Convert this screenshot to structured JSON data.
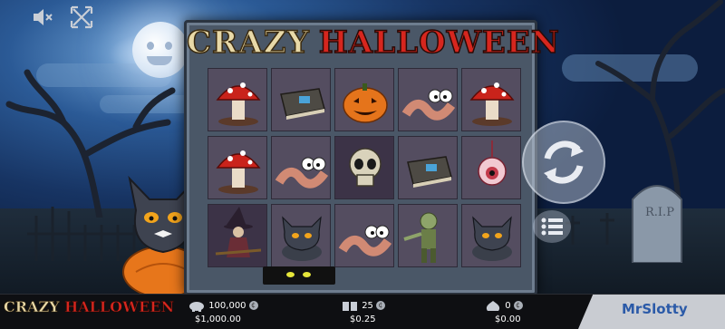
{
  "game": {
    "logo_word1": "CRAZY",
    "logo_word2": "HALLOWEEN"
  },
  "toolbar": {
    "mute_icon": "speaker-muted-icon",
    "fullscreen_icon": "fullscreen-icon"
  },
  "controls": {
    "spin_icon": "spin-arrows-icon",
    "menu_icon": "menu-list-icon"
  },
  "reels": [
    [
      "mushroom",
      "spellbook",
      "pumpkin",
      "worm",
      "mushroom"
    ],
    [
      "mushroom",
      "worm",
      "skull",
      "spellbook",
      "eyeball"
    ],
    [
      "witch",
      "cat-on-pumpkin-wild",
      "worm",
      "zombie",
      "cat-on-pumpkin-wild"
    ]
  ],
  "footer": {
    "logo_word1": "CRAZY",
    "logo_word2": "HALLOWEEN",
    "balance_coins": "100,000",
    "balance_money": "$1,000.00",
    "bet_coins": "25",
    "bet_money": "$0.25",
    "win_coins": "0",
    "win_money": "$0.00",
    "coin_symbol": "¢",
    "brand": "MrSlotty"
  },
  "colors": {
    "logo_red": "#d6261e",
    "logo_cream": "#e8d9a8",
    "brand_blue": "#2b5aa8"
  }
}
